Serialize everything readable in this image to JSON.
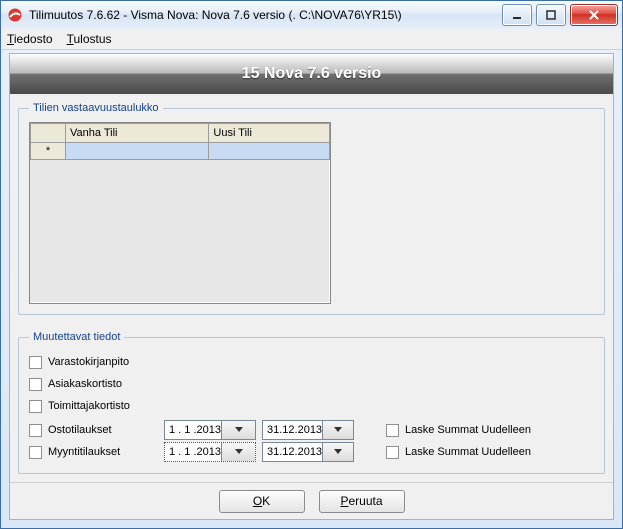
{
  "window": {
    "title": "Tilimuutos 7.6.62 - Visma Nova: Nova 7.6 versio (. C:\\NOVA76\\YR15\\)"
  },
  "menu": {
    "file_full": "Tiedosto",
    "file_u": "T",
    "file_rest": "iedosto",
    "print_full": "Tulostus",
    "print_u": "T",
    "print_rest": "ulostus"
  },
  "banner": {
    "text": "15 Nova 7.6 versio"
  },
  "mapping": {
    "legend": "Tilien vastaavuustaulukko",
    "col_old": "Vanha Tili",
    "col_new": "Uusi Tili",
    "new_row_marker": "*"
  },
  "change": {
    "legend": "Muutettavat tiedot",
    "stock": "Varastokirjanpito",
    "customers": "Asiakaskortisto",
    "suppliers": "Toimittajakortisto",
    "purchase_orders": "Ostotilaukset",
    "sales_orders": "Myyntitilaukset",
    "recalc": "Laske Summat Uudelleen",
    "po_from": "1 . 1 .2013",
    "po_to": "31.12.2013",
    "so_from": "1 . 1 .2013",
    "so_to": "31.12.2013"
  },
  "buttons": {
    "ok_u": "O",
    "ok_rest": "K",
    "cancel_u": "P",
    "cancel_rest": "eruuta"
  }
}
